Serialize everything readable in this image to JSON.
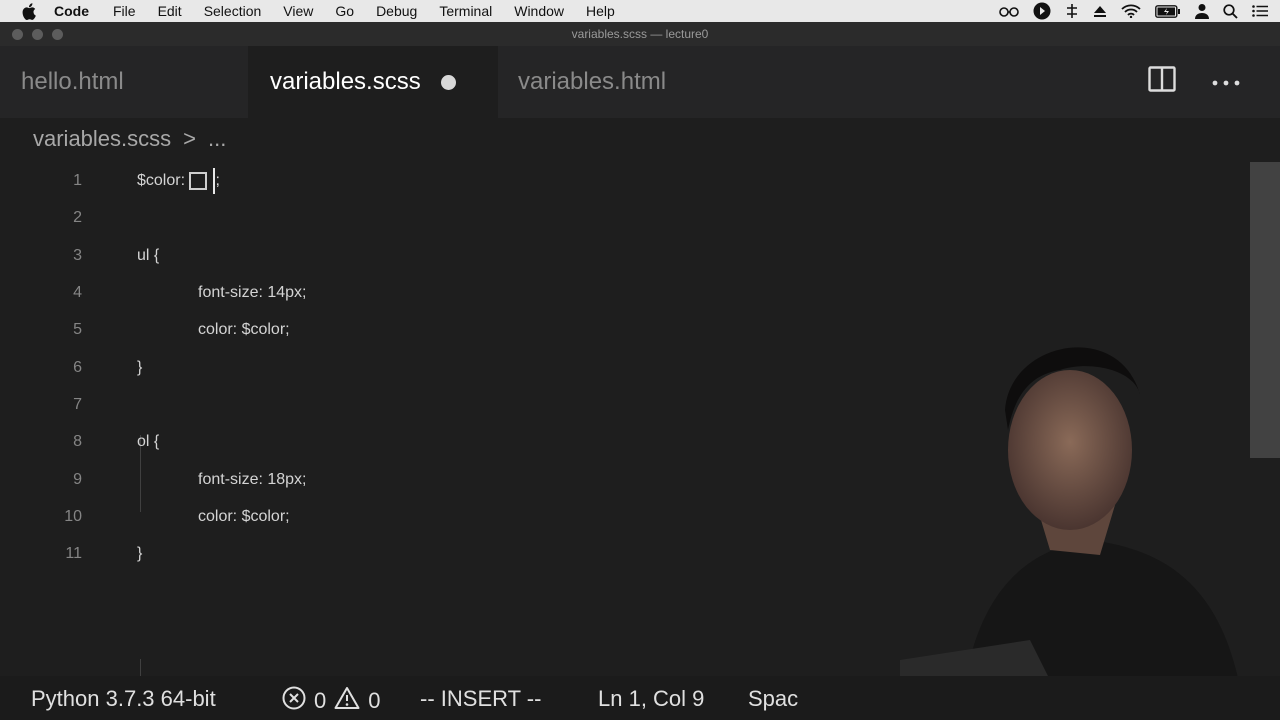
{
  "menubar": {
    "app_name": "Code",
    "items": [
      "File",
      "Edit",
      "Selection",
      "View",
      "Go",
      "Debug",
      "Terminal",
      "Window",
      "Help"
    ]
  },
  "window": {
    "title": "variables.scss — lecture0"
  },
  "tabs": [
    {
      "label": "hello.html",
      "active": false,
      "dirty": false
    },
    {
      "label": "variables.scss",
      "active": true,
      "dirty": true
    },
    {
      "label": "variables.html",
      "active": false,
      "dirty": false
    }
  ],
  "breadcrumb": {
    "file": "variables.scss",
    "separator": ">",
    "rest": "..."
  },
  "editor": {
    "lines": [
      {
        "number": "1",
        "text": "$color: ",
        "after_cursor": ";"
      },
      {
        "number": "2",
        "text": ""
      },
      {
        "number": "3",
        "text": "ul {"
      },
      {
        "number": "4",
        "text": "font-size: 14px;"
      },
      {
        "number": "5",
        "text": "color: $color;"
      },
      {
        "number": "6",
        "text": "}"
      },
      {
        "number": "7",
        "text": ""
      },
      {
        "number": "8",
        "text": "ol {"
      },
      {
        "number": "9",
        "text": "font-size: 18px;"
      },
      {
        "number": "10",
        "text": "color: $color;"
      },
      {
        "number": "11",
        "text": "}"
      }
    ]
  },
  "statusbar": {
    "interpreter": "Python 3.7.3 64-bit",
    "errors": "0",
    "warnings": "0",
    "mode": "-- INSERT --",
    "position": "Ln 1, Col 9",
    "indent": "Spac"
  },
  "colors": {
    "editor_bg": "#1e1e1e",
    "tabbar_bg": "#252526",
    "menubar_bg": "#e8e8e8",
    "text": "#d4d4d4",
    "line_number": "#858585"
  },
  "icons": {
    "apple": "apple-logo-icon",
    "split": "split-editor-icon",
    "more": "more-actions-icon",
    "error": "error-circle-icon",
    "warning": "warning-triangle-icon"
  }
}
